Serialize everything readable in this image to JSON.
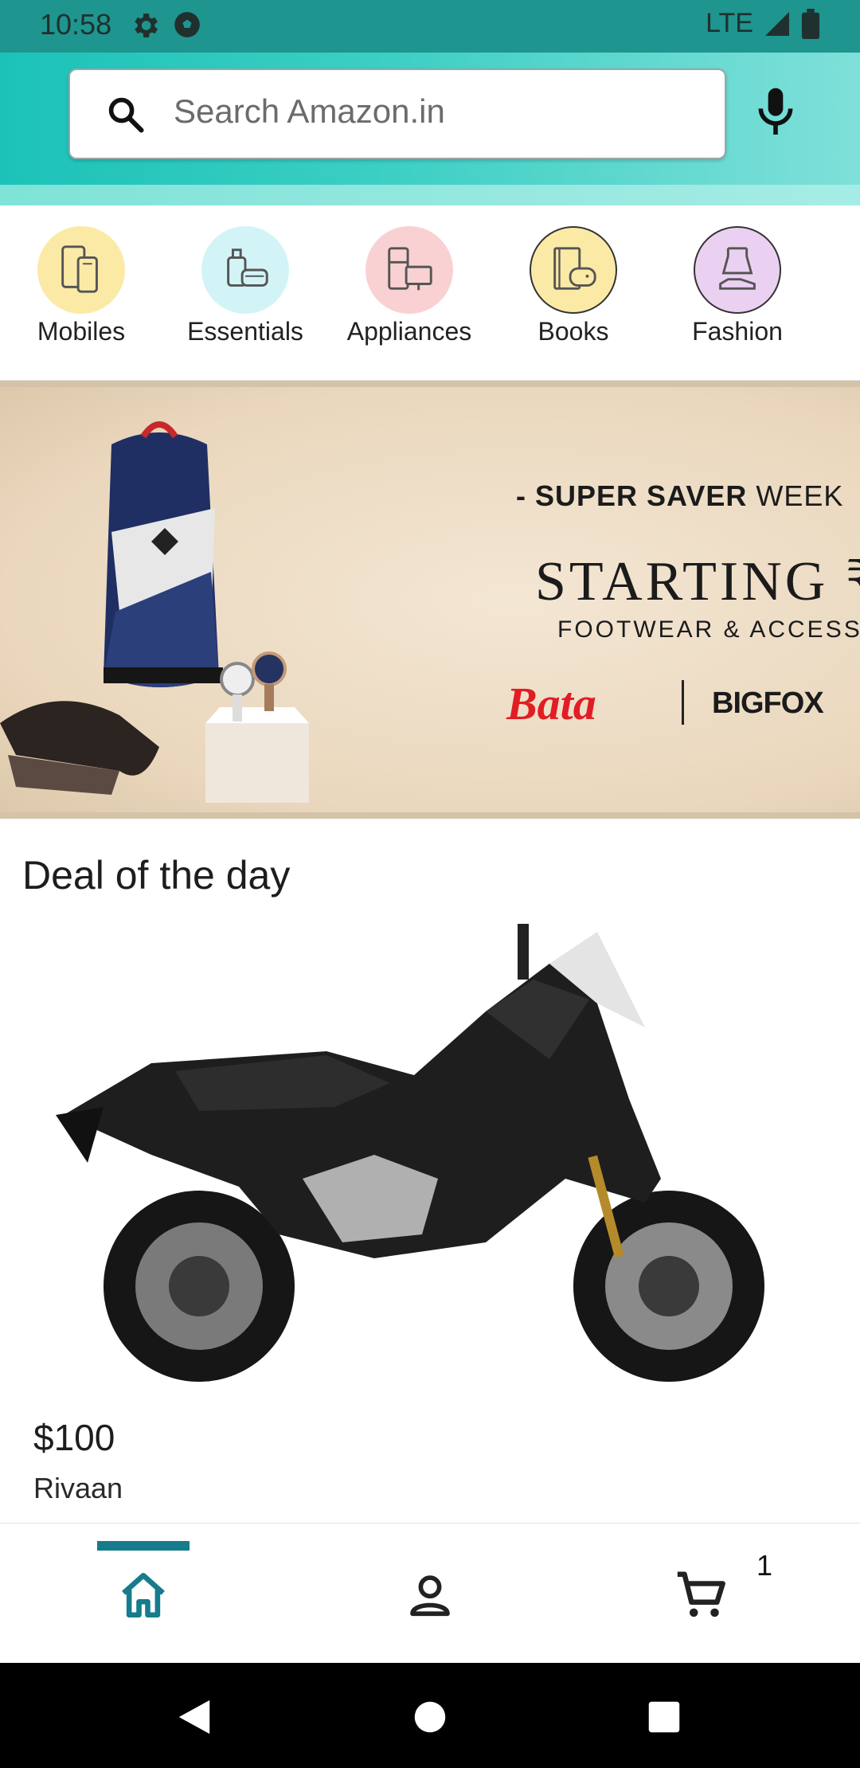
{
  "status_bar": {
    "time": "10:58",
    "left_icons": [
      "settings-gear-icon",
      "soccer-ball-icon"
    ],
    "network": "LTE",
    "right_icons": [
      "signal-icon",
      "battery-icon"
    ]
  },
  "search": {
    "placeholder": "Search Amazon.in",
    "icons": [
      "search-icon",
      "mic-icon"
    ]
  },
  "categories": [
    {
      "label": "Mobiles",
      "icon": "mobiles-icon",
      "color": "#fbeaa6"
    },
    {
      "label": "Essentials",
      "icon": "essentials-icon",
      "color": "#d3f4f7"
    },
    {
      "label": "Appliances",
      "icon": "appliances-icon",
      "color": "#f9d1d3"
    },
    {
      "label": "Books",
      "icon": "books-icon",
      "color": "#fbeaa6"
    },
    {
      "label": "Fashion",
      "icon": "fashion-icon",
      "color": "#ebd1f1"
    }
  ],
  "banner": {
    "line1_prefix": "- SUPER SAVER",
    "line1_suffix": "WEEK",
    "line2": "STARTING ₹",
    "line3": "FOOTWEAR & ACCESSO",
    "brand1": "Bata",
    "brand2": "BIGFOX"
  },
  "deal": {
    "title": "Deal of the day",
    "price": "$100",
    "name": "Rivaan"
  },
  "bottom_nav": {
    "items": [
      "home-icon",
      "account-icon",
      "cart-icon"
    ],
    "active": "home",
    "cart_count": "1",
    "accent": "#167c8b"
  },
  "system_nav": [
    "back-icon",
    "home-circle-icon",
    "recents-icon"
  ]
}
